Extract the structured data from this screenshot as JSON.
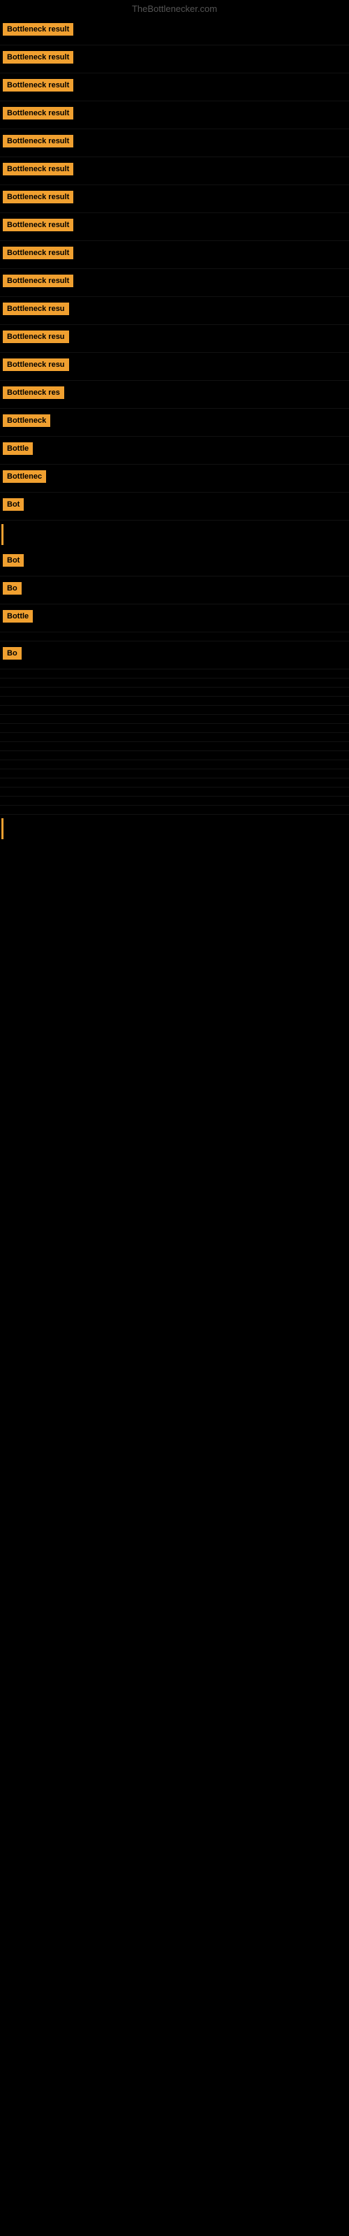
{
  "site": {
    "title": "TheBottlenecker.com"
  },
  "results": [
    {
      "label": "Bottleneck result",
      "width": 150,
      "visible": true
    },
    {
      "label": "Bottleneck result",
      "width": 150,
      "visible": true
    },
    {
      "label": "Bottleneck result",
      "width": 150,
      "visible": true
    },
    {
      "label": "Bottleneck result",
      "width": 150,
      "visible": true
    },
    {
      "label": "Bottleneck result",
      "width": 150,
      "visible": true
    },
    {
      "label": "Bottleneck result",
      "width": 150,
      "visible": true
    },
    {
      "label": "Bottleneck result",
      "width": 150,
      "visible": true
    },
    {
      "label": "Bottleneck result",
      "width": 150,
      "visible": true
    },
    {
      "label": "Bottleneck result",
      "width": 150,
      "visible": true
    },
    {
      "label": "Bottleneck result",
      "width": 150,
      "visible": true
    },
    {
      "label": "Bottleneck resu",
      "width": 120,
      "visible": true
    },
    {
      "label": "Bottleneck resu",
      "width": 120,
      "visible": true
    },
    {
      "label": "Bottleneck resu",
      "width": 120,
      "visible": true
    },
    {
      "label": "Bottleneck res",
      "width": 110,
      "visible": true
    },
    {
      "label": "Bottleneck",
      "width": 85,
      "visible": true
    },
    {
      "label": "Bottle",
      "width": 55,
      "visible": true
    },
    {
      "label": "Bottlenec",
      "width": 75,
      "visible": true
    },
    {
      "label": "Bot",
      "width": 35,
      "visible": true
    },
    {
      "label": "",
      "width": 0,
      "visible": false,
      "bar": true
    },
    {
      "label": "Bot",
      "width": 35,
      "visible": true
    },
    {
      "label": "Bo",
      "width": 25,
      "visible": true
    },
    {
      "label": "Bottle",
      "width": 55,
      "visible": true
    },
    {
      "label": "",
      "width": 0,
      "visible": false
    },
    {
      "label": "Bo",
      "width": 25,
      "visible": true
    },
    {
      "label": "",
      "width": 0,
      "visible": false
    },
    {
      "label": "",
      "width": 0,
      "visible": false
    },
    {
      "label": "",
      "width": 0,
      "visible": false
    },
    {
      "label": "",
      "width": 0,
      "visible": false
    },
    {
      "label": "",
      "width": 0,
      "visible": false
    },
    {
      "label": "",
      "width": 0,
      "visible": false
    },
    {
      "label": "",
      "width": 0,
      "visible": false
    },
    {
      "label": "",
      "width": 0,
      "visible": false
    },
    {
      "label": "",
      "width": 0,
      "visible": false
    },
    {
      "label": "",
      "width": 0,
      "visible": false
    },
    {
      "label": "",
      "width": 0,
      "visible": false
    },
    {
      "label": "",
      "width": 0,
      "visible": false
    },
    {
      "label": "",
      "width": 0,
      "visible": false
    },
    {
      "label": "",
      "width": 0,
      "visible": false
    },
    {
      "label": "",
      "width": 0,
      "visible": false
    },
    {
      "label": "",
      "width": 0,
      "visible": false
    },
    {
      "label": "",
      "width": 0,
      "visible": false,
      "bar": true
    }
  ],
  "colors": {
    "badge": "#f0a030",
    "background": "#000000",
    "text": "#000000",
    "site_title": "#555555",
    "bar": "#f0a030"
  }
}
